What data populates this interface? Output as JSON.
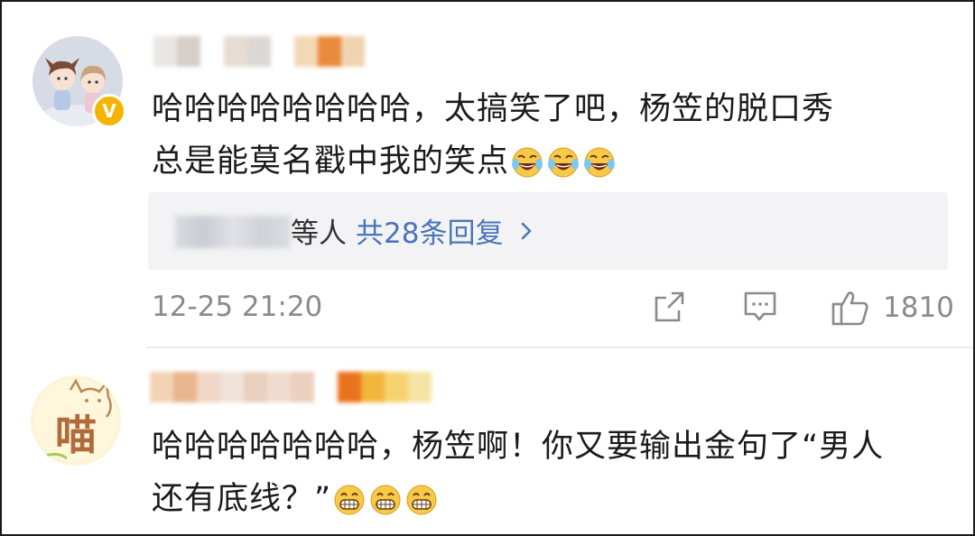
{
  "comments": [
    {
      "text_line1": "哈哈哈哈哈哈哈哈，太搞笑了吧，杨笠的脱口秀",
      "text_line2": "总是能莫名戳中我的笑点",
      "emoji_icons": [
        "laugh-tears-icon",
        "laugh-tears-icon",
        "laugh-tears-icon"
      ],
      "verified_badge": "V",
      "reply_people_suffix": "等人",
      "reply_count_label": "共28条回复",
      "timestamp": "12-25 21:20",
      "like_count": "1810",
      "colors": {
        "verified": "#f4b400",
        "link": "#4a76b8"
      }
    },
    {
      "text_line1": "哈哈哈哈哈哈哈，杨笠啊！你又要输出金句了“男人",
      "text_line2": "还有底线？”",
      "emoji_icons": [
        "grin-icon",
        "grin-icon",
        "grin-icon"
      ],
      "avatar_text": "喵"
    }
  ]
}
